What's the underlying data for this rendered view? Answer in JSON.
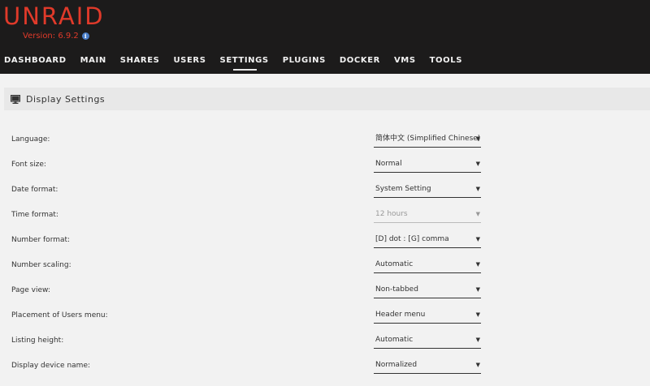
{
  "header": {
    "logo_text": "UNRAID",
    "version_text": "Version: 6.9.2",
    "brand_color": "#e03a2a",
    "info_icon": "info-icon"
  },
  "nav": {
    "items": [
      {
        "label": "DASHBOARD",
        "active": false
      },
      {
        "label": "MAIN",
        "active": false
      },
      {
        "label": "SHARES",
        "active": false
      },
      {
        "label": "USERS",
        "active": false
      },
      {
        "label": "SETTINGS",
        "active": true
      },
      {
        "label": "PLUGINS",
        "active": false
      },
      {
        "label": "DOCKER",
        "active": false
      },
      {
        "label": "VMS",
        "active": false
      },
      {
        "label": "TOOLS",
        "active": false
      }
    ]
  },
  "panel": {
    "title": "Display Settings",
    "icon": "monitor-icon"
  },
  "settings": [
    {
      "label": "Language:",
      "value": "简体中文 (Simplified Chinese)",
      "disabled": false
    },
    {
      "label": "Font size:",
      "value": "Normal",
      "disabled": false
    },
    {
      "label": "Date format:",
      "value": "System Setting",
      "disabled": false
    },
    {
      "label": "Time format:",
      "value": "12 hours",
      "disabled": true
    },
    {
      "label": "Number format:",
      "value": "[D] dot : [G] comma",
      "disabled": false
    },
    {
      "label": "Number scaling:",
      "value": "Automatic",
      "disabled": false
    },
    {
      "label": "Page view:",
      "value": "Non-tabbed",
      "disabled": false
    },
    {
      "label": "Placement of Users menu:",
      "value": "Header menu",
      "disabled": false
    },
    {
      "label": "Listing height:",
      "value": "Automatic",
      "disabled": false
    },
    {
      "label": "Display device name:",
      "value": "Normalized",
      "disabled": false
    }
  ]
}
